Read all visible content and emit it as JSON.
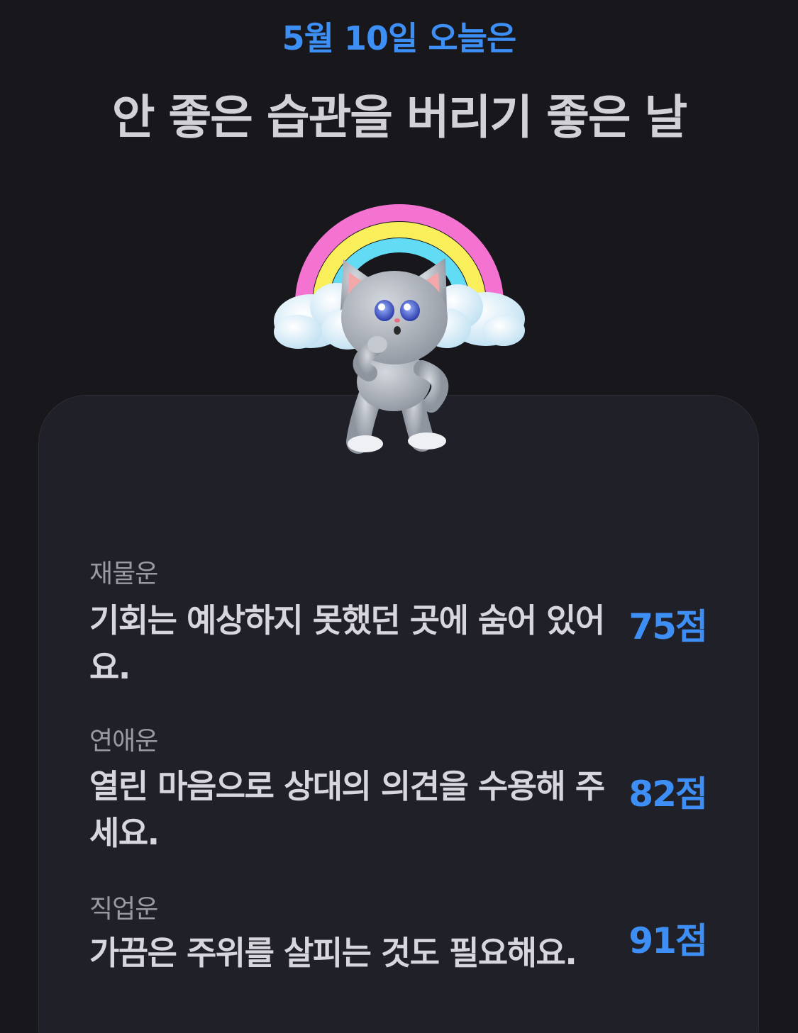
{
  "date_line": "5월 10일 오늘은",
  "headline": "안 좋은 습관을 버리기 좋은 날",
  "mascot": {
    "icon": "cat-rainbow-mascot",
    "colors": {
      "rainbow_outer": "#f472d0",
      "rainbow_middle": "#f8ef5a",
      "rainbow_inner": "#62dcf5",
      "cat_body": "#a9aeb8",
      "cloud": "#e8f3fa"
    }
  },
  "fortunes": [
    {
      "label": "재물운",
      "text": "기회는 예상하지 못했던 곳에 숨어 있어요.",
      "score": "75점"
    },
    {
      "label": "연애운",
      "text": "열린 마음으로 상대의 의견을 수용해 주세요.",
      "score": "82점"
    },
    {
      "label": "직업운",
      "text": "가끔은 주위를 살피는 것도 필요해요.",
      "score": "91점"
    }
  ],
  "colors": {
    "accent": "#3d8ff5",
    "background": "#17171c",
    "card": "#202028"
  }
}
